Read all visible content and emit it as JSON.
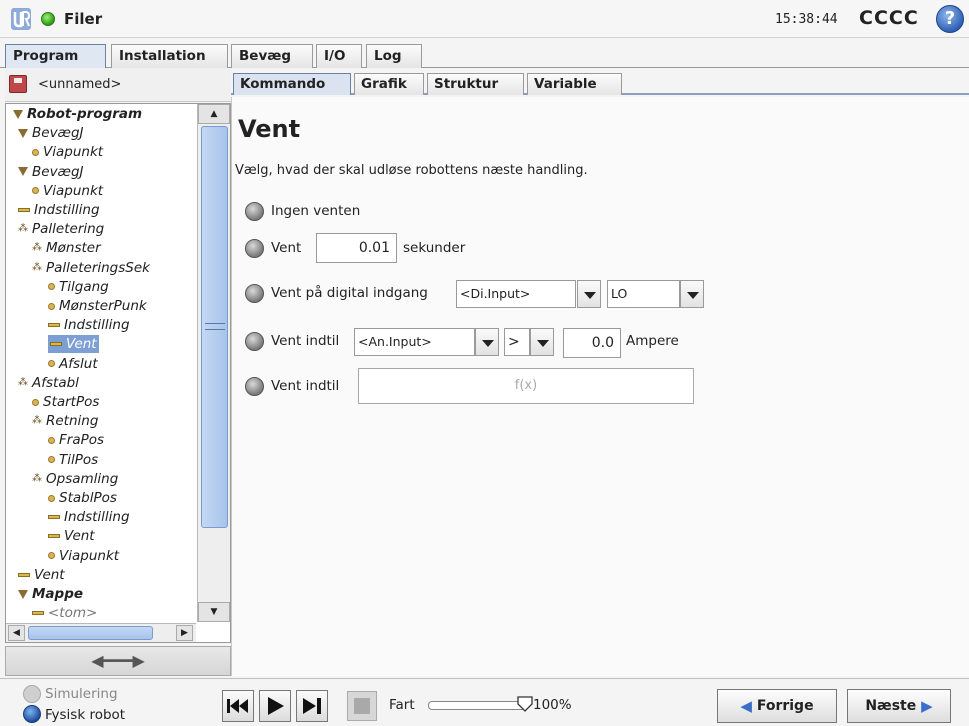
{
  "titlebar": {
    "title": "Filer",
    "time": "15:38:44",
    "robot_name": "CCCC",
    "help_glyph": "?"
  },
  "top_tabs": [
    "Program",
    "Installation",
    "Bevæg",
    "I/O",
    "Log"
  ],
  "program": {
    "filename": "<unnamed>"
  },
  "tree": [
    {
      "label": "Robot-program",
      "icon": "triangle-icon",
      "bold": true
    },
    {
      "label": "BevægJ",
      "icon": "triangle-icon"
    },
    {
      "label": "Viapunkt",
      "icon": "waypoint-icon"
    },
    {
      "label": "BevægJ",
      "icon": "triangle-icon"
    },
    {
      "label": "Viapunkt",
      "icon": "waypoint-icon"
    },
    {
      "label": "Indstilling",
      "icon": "set-icon"
    },
    {
      "label": "Palletering",
      "icon": "pallet-icon"
    },
    {
      "label": "Mønster",
      "icon": "pallet-icon"
    },
    {
      "label": "PalleteringsSek",
      "icon": "pallet-icon"
    },
    {
      "label": "Tilgang",
      "icon": "waypoint-icon"
    },
    {
      "label": "MønsterPunk",
      "icon": "waypoint-icon"
    },
    {
      "label": "Indstilling",
      "icon": "set-icon"
    },
    {
      "label": "Vent",
      "icon": "set-icon",
      "selected": true
    },
    {
      "label": "Afslut",
      "icon": "waypoint-icon"
    },
    {
      "label": "Afstabl",
      "icon": "pallet-icon"
    },
    {
      "label": "StartPos",
      "icon": "waypoint-icon"
    },
    {
      "label": "Retning",
      "icon": "pallet-icon"
    },
    {
      "label": "FraPos",
      "icon": "waypoint-icon"
    },
    {
      "label": "TilPos",
      "icon": "waypoint-icon"
    },
    {
      "label": "Opsamling",
      "icon": "pallet-icon"
    },
    {
      "label": "StablPos",
      "icon": "waypoint-icon"
    },
    {
      "label": "Indstilling",
      "icon": "set-icon"
    },
    {
      "label": "Vent",
      "icon": "set-icon"
    },
    {
      "label": "Viapunkt",
      "icon": "waypoint-icon"
    },
    {
      "label": "Vent",
      "icon": "set-icon"
    },
    {
      "label": "Mappe",
      "icon": "triangle-icon",
      "bold": true
    },
    {
      "label": "<tom>",
      "icon": "set-icon",
      "grey": true
    }
  ],
  "sub_tabs": [
    "Kommando",
    "Grafik",
    "Struktur",
    "Variable"
  ],
  "wait": {
    "heading": "Vent",
    "description": "Vælg, hvad der skal udløse robottens næste handling.",
    "opt_none": "Ingen venten",
    "opt_time": "Vent",
    "time_value": "0.01",
    "time_unit": "sekunder",
    "opt_digital": "Vent på digital indgang",
    "digital_input": "<Di.Input>",
    "digital_level": "LO",
    "opt_analog": "Vent indtil",
    "analog_input": "<An.Input>",
    "analog_operator": ">",
    "analog_value": "0.0",
    "analog_unit": "Ampere",
    "opt_expr": "Vent indtil",
    "expr_placeholder": "f(x)"
  },
  "bottom": {
    "simulation": "Simulering",
    "physical": "Fysisk robot",
    "speed_label": "Fart",
    "speed_pct": "100%",
    "speed_fraction": 1.0,
    "prev": "Forrige",
    "next": "Næste"
  }
}
